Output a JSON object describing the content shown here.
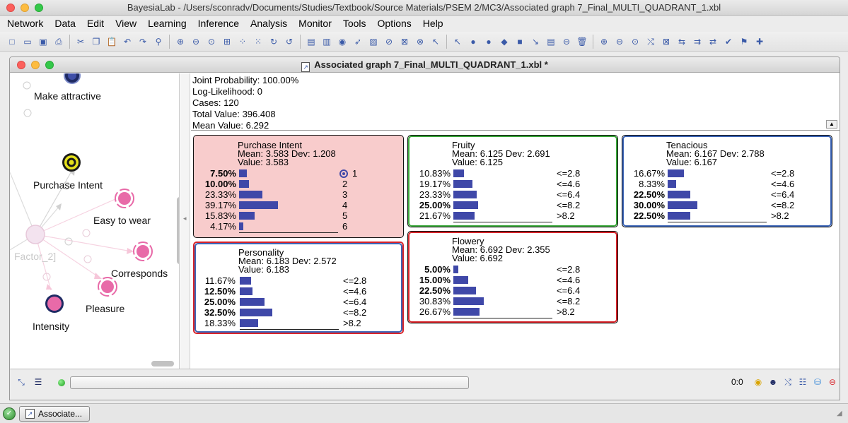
{
  "window": {
    "title": "BayesiaLab - /Users/sconradv/Documents/Studies/Textbook/Source Materials/PSEM 2/MC3/Associated graph 7_Final_MULTI_QUADRANT_1.xbl"
  },
  "menubar": [
    "Network",
    "Data",
    "Edit",
    "View",
    "Learning",
    "Inference",
    "Analysis",
    "Monitor",
    "Tools",
    "Options",
    "Help"
  ],
  "toolbar": {
    "groups": [
      [
        {
          "name": "new-icon",
          "glyph": "□"
        },
        {
          "name": "open-icon",
          "glyph": "▭"
        },
        {
          "name": "save-icon",
          "glyph": "▣"
        },
        {
          "name": "print-icon",
          "glyph": "⎙"
        }
      ],
      [
        {
          "name": "cut-icon",
          "glyph": "✂"
        },
        {
          "name": "copy-icon",
          "glyph": "❐"
        },
        {
          "name": "paste-icon",
          "glyph": "📋"
        },
        {
          "name": "undo-icon",
          "glyph": "↶"
        },
        {
          "name": "redo-icon",
          "glyph": "↷"
        },
        {
          "name": "find-icon",
          "glyph": "⚲"
        }
      ],
      [
        {
          "name": "zoom-in-icon",
          "glyph": "⊕"
        },
        {
          "name": "zoom-out-icon",
          "glyph": "⊖"
        },
        {
          "name": "zoom-fit-icon",
          "glyph": "⊙"
        },
        {
          "name": "fit-window-icon",
          "glyph": "⊞"
        },
        {
          "name": "layout-icon",
          "glyph": "⁘"
        },
        {
          "name": "layout-alt-icon",
          "glyph": "⁙"
        },
        {
          "name": "rotate-right-icon",
          "glyph": "↻"
        },
        {
          "name": "rotate-left-icon",
          "glyph": "↺"
        }
      ],
      [
        {
          "name": "monitor-icon",
          "glyph": "▤"
        },
        {
          "name": "evidence-icon",
          "glyph": "▥"
        },
        {
          "name": "target-node-icon",
          "glyph": "◉"
        },
        {
          "name": "arc-icon",
          "glyph": "➶"
        },
        {
          "name": "image-icon",
          "glyph": "▨"
        },
        {
          "name": "disable-icon",
          "glyph": "⊘"
        },
        {
          "name": "filter-icon",
          "glyph": "⊠"
        },
        {
          "name": "forbid-icon",
          "glyph": "⊗"
        },
        {
          "name": "pointer-arrow-icon",
          "glyph": "↖"
        }
      ],
      [
        {
          "name": "select-icon",
          "glyph": "↖"
        },
        {
          "name": "node-icon",
          "glyph": "●"
        },
        {
          "name": "decision-node-icon",
          "glyph": "●"
        },
        {
          "name": "utility-node-icon",
          "glyph": "◆"
        },
        {
          "name": "constraint-node-icon",
          "glyph": "■"
        },
        {
          "name": "arrow-tool-icon",
          "glyph": "↘"
        },
        {
          "name": "note-icon",
          "glyph": "▤"
        },
        {
          "name": "delete-node-icon",
          "glyph": "⊖"
        },
        {
          "name": "trash-icon",
          "glyph": "🗑"
        }
      ],
      [
        {
          "name": "search-zoom-icon",
          "glyph": "⊕"
        },
        {
          "name": "search-zoom-out-icon",
          "glyph": "⊖"
        },
        {
          "name": "search-fit-icon",
          "glyph": "⊙"
        },
        {
          "name": "connect-icon",
          "glyph": "⤭"
        },
        {
          "name": "hide-icon",
          "glyph": "⊠"
        },
        {
          "name": "link-icon",
          "glyph": "⇆"
        },
        {
          "name": "arrows-in-icon",
          "glyph": "⇉"
        },
        {
          "name": "arrows-swap-icon",
          "glyph": "⇄"
        },
        {
          "name": "check-icon",
          "glyph": "✔"
        },
        {
          "name": "flag-icon",
          "glyph": "⚑"
        },
        {
          "name": "add-icon",
          "glyph": "✚"
        }
      ]
    ]
  },
  "document": {
    "title": "Associated graph 7_Final_MULTI_QUADRANT_1.xbl *"
  },
  "graph": {
    "labels": [
      {
        "id": "make-attractive",
        "text": "Make attractive",
        "faded": false
      },
      {
        "id": "purchase-intent",
        "text": "Purchase Intent",
        "faded": false
      },
      {
        "id": "easy-to-wear",
        "text": "Easy to wear",
        "faded": false
      },
      {
        "id": "factor-2",
        "text": "Factor_2]",
        "faded": true
      },
      {
        "id": "corresponds",
        "text": "Corresponds",
        "faded": false
      },
      {
        "id": "pleasure",
        "text": "Pleasure",
        "faded": false
      },
      {
        "id": "intensity",
        "text": "Intensity",
        "faded": false
      }
    ]
  },
  "stats": {
    "joint_probability": "Joint Probability: 100.00%",
    "log_likelihood": "Log-Likelihood: 0",
    "cases": "Cases: 120",
    "total_value": "Total Value: 396.408",
    "mean_value": "Mean Value: 6.292"
  },
  "monitors": [
    {
      "id": "purchase-intent",
      "title": "Purchase Intent",
      "mean": "Mean: 3.583 Dev: 1.208",
      "value": "Value: 3.583",
      "bg": "#f8cccc",
      "border": "#111111",
      "ring": "",
      "target": true,
      "rows": [
        {
          "pct": "7.50%",
          "p": 7.5,
          "state": "1",
          "bold": true
        },
        {
          "pct": "10.00%",
          "p": 10.0,
          "state": "2",
          "bold": true
        },
        {
          "pct": "23.33%",
          "p": 23.33,
          "state": "3",
          "bold": false
        },
        {
          "pct": "39.17%",
          "p": 39.17,
          "state": "4",
          "bold": false
        },
        {
          "pct": "15.83%",
          "p": 15.83,
          "state": "5",
          "bold": false
        },
        {
          "pct": "4.17%",
          "p": 4.17,
          "state": "6",
          "bold": false
        }
      ]
    },
    {
      "id": "fruity",
      "title": "Fruity",
      "mean": "Mean: 6.125 Dev: 2.691",
      "value": "Value: 6.125",
      "bg": "#ffffff",
      "border": "#111111",
      "ring": "#3aa83a",
      "target": false,
      "rows": [
        {
          "pct": "10.83%",
          "p": 10.83,
          "state": "<=2.8",
          "bold": false
        },
        {
          "pct": "19.17%",
          "p": 19.17,
          "state": "<=4.6",
          "bold": false
        },
        {
          "pct": "23.33%",
          "p": 23.33,
          "state": "<=6.4",
          "bold": false
        },
        {
          "pct": "25.00%",
          "p": 25.0,
          "state": "<=8.2",
          "bold": true
        },
        {
          "pct": "21.67%",
          "p": 21.67,
          "state": ">8.2",
          "bold": false
        }
      ]
    },
    {
      "id": "tenacious",
      "title": "Tenacious",
      "mean": "Mean: 6.167 Dev: 2.788",
      "value": "Value: 6.167",
      "bg": "#ffffff",
      "border": "#111111",
      "ring": "#3d66b8",
      "target": false,
      "rows": [
        {
          "pct": "16.67%",
          "p": 16.67,
          "state": "<=2.8",
          "bold": false
        },
        {
          "pct": "8.33%",
          "p": 8.33,
          "state": "<=4.6",
          "bold": false
        },
        {
          "pct": "22.50%",
          "p": 22.5,
          "state": "<=6.4",
          "bold": true
        },
        {
          "pct": "30.00%",
          "p": 30.0,
          "state": "<=8.2",
          "bold": true
        },
        {
          "pct": "22.50%",
          "p": 22.5,
          "state": ">8.2",
          "bold": true
        }
      ]
    },
    {
      "id": "personality",
      "title": "Personality",
      "mean": "Mean: 6.183 Dev: 2.572",
      "value": "Value: 6.183",
      "bg": "#ffffff",
      "border": "#d8242a",
      "ring": "#3d66b8",
      "target": false,
      "rows": [
        {
          "pct": "11.67%",
          "p": 11.67,
          "state": "<=2.8",
          "bold": false
        },
        {
          "pct": "12.50%",
          "p": 12.5,
          "state": "<=4.6",
          "bold": true
        },
        {
          "pct": "25.00%",
          "p": 25.0,
          "state": "<=6.4",
          "bold": true
        },
        {
          "pct": "32.50%",
          "p": 32.5,
          "state": "<=8.2",
          "bold": true
        },
        {
          "pct": "18.33%",
          "p": 18.33,
          "state": ">8.2",
          "bold": false
        }
      ]
    },
    {
      "id": "flowery",
      "title": "Flowery",
      "mean": "Mean: 6.692 Dev: 2.355",
      "value": "Value: 6.692",
      "bg": "#ffffff",
      "border": "#111111",
      "ring": "#d8242a",
      "target": false,
      "rows": [
        {
          "pct": "5.00%",
          "p": 5.0,
          "state": "<=2.8",
          "bold": true
        },
        {
          "pct": "15.00%",
          "p": 15.0,
          "state": "<=4.6",
          "bold": true
        },
        {
          "pct": "22.50%",
          "p": 22.5,
          "state": "<=6.4",
          "bold": true
        },
        {
          "pct": "30.83%",
          "p": 30.83,
          "state": "<=8.2",
          "bold": false
        },
        {
          "pct": "26.67%",
          "p": 26.67,
          "state": ">8.2",
          "bold": false
        }
      ]
    }
  ],
  "status": {
    "coords": "0:0"
  },
  "taskbar": {
    "item_label": "Associate..."
  },
  "colors": {
    "bar": "#3f48a8",
    "node_pink": "#e86aa8",
    "node_navy": "#1e2a63"
  }
}
